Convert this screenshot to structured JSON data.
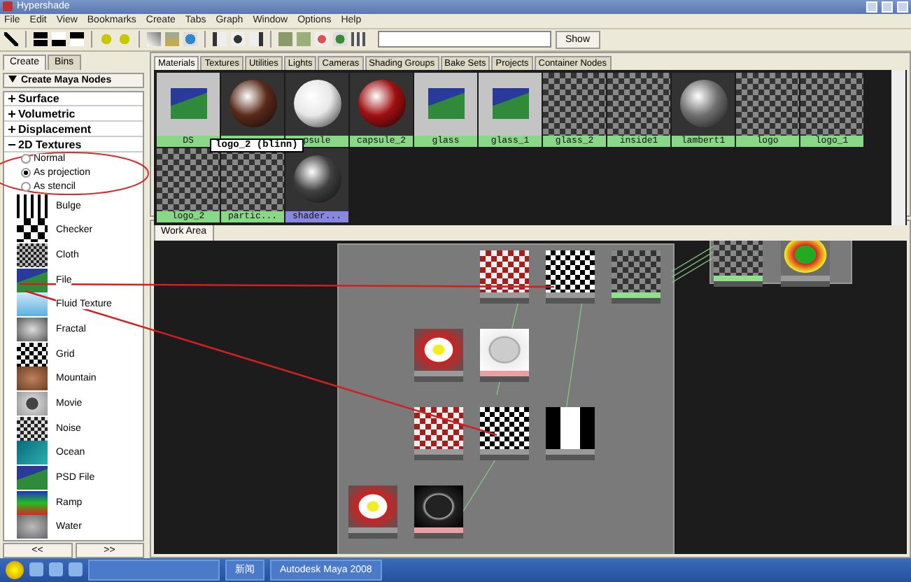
{
  "window": {
    "title": "Hypershade"
  },
  "menu": [
    "File",
    "Edit",
    "View",
    "Bookmarks",
    "Create",
    "Tabs",
    "Graph",
    "Window",
    "Options",
    "Help"
  ],
  "toolbar": {
    "show_button": "Show"
  },
  "sidebar": {
    "tabs": [
      {
        "label": "Create",
        "selected": true
      },
      {
        "label": "Bins",
        "selected": false
      }
    ],
    "header": "Create Maya Nodes",
    "sections": [
      {
        "label": "Surface",
        "expanded": false
      },
      {
        "label": "Volumetric",
        "expanded": false
      },
      {
        "label": "Displacement",
        "expanded": false
      },
      {
        "label": "2D Textures",
        "expanded": true
      }
    ],
    "modes": [
      {
        "label": "Normal",
        "selected": false
      },
      {
        "label": "As projection",
        "selected": true
      },
      {
        "label": "As stencil",
        "selected": false
      }
    ],
    "items": [
      "Bulge",
      "Checker",
      "Cloth",
      "File",
      "Fluid Texture",
      "Fractal",
      "Grid",
      "Mountain",
      "Movie",
      "Noise",
      "Ocean",
      "PSD File",
      "Ramp",
      "Water"
    ],
    "pager": [
      "<<",
      ">>"
    ]
  },
  "materials": {
    "tabs": [
      {
        "label": "Materials",
        "selected": true
      },
      {
        "label": "Textures",
        "selected": false
      },
      {
        "label": "Utilities",
        "selected": false
      },
      {
        "label": "Lights",
        "selected": false
      },
      {
        "label": "Cameras",
        "selected": false
      },
      {
        "label": "Shading Groups",
        "selected": false
      },
      {
        "label": "Bake Sets",
        "selected": false
      },
      {
        "label": "Projects",
        "selected": false
      },
      {
        "label": "Container Nodes",
        "selected": false
      }
    ],
    "swatches": [
      {
        "kind": "file",
        "label": "DS",
        "selected": false
      },
      {
        "kind": "sphere",
        "color": "#5a2a1a",
        "selected": false
      },
      {
        "kind": "sphere",
        "color": "#e8e8e8",
        "label": "psule",
        "selected": false
      },
      {
        "kind": "sphere",
        "color": "#a01010",
        "label": "capsule_2",
        "selected": false
      },
      {
        "kind": "file",
        "label": "glass",
        "selected": false
      },
      {
        "kind": "file",
        "label": "glass_1",
        "selected": false
      },
      {
        "kind": "checker",
        "label": "glass_2",
        "selected": false
      },
      {
        "kind": "checker",
        "label": "inside1",
        "selected": false
      },
      {
        "kind": "sphere",
        "color": "#707070",
        "label": "lambert1",
        "selected": false
      },
      {
        "kind": "checker",
        "label": "logo",
        "selected": false
      },
      {
        "kind": "checker",
        "label": "logo_1",
        "selected": false
      },
      {
        "kind": "checker",
        "label": "logo_2",
        "selected": false
      },
      {
        "kind": "checker",
        "label": "partic...",
        "selected": false
      },
      {
        "kind": "sphere",
        "color": "#404040",
        "label": "shader...",
        "selected": true
      }
    ],
    "tooltip": "logo_2 (blinn)"
  },
  "work_area": {
    "tab": "Work Area",
    "nodes": [
      {
        "kind": "placement",
        "color": "#9a9a9a"
      },
      {
        "kind": "projection",
        "color": "#9a9a9a"
      },
      {
        "kind": "checker",
        "color": "#90e090"
      },
      {
        "kind": "placement2d",
        "color": "#9a9a9a"
      },
      {
        "kind": "file",
        "color": "#e8a0a0"
      },
      {
        "kind": "placement",
        "color": "#9a9a9a"
      },
      {
        "kind": "projection",
        "color": "#9a9a9a"
      },
      {
        "kind": "stencil",
        "color": "#9a9a9a"
      },
      {
        "kind": "placement2d",
        "color": "#9a9a9a"
      },
      {
        "kind": "filedark",
        "color": "#e8a0a0"
      },
      {
        "kind": "checker",
        "color": "#90e090"
      },
      {
        "kind": "ball",
        "color": "#9a9a9a"
      }
    ]
  },
  "taskbar": {
    "items": [
      "新闻",
      "Autodesk Maya 2008"
    ]
  }
}
